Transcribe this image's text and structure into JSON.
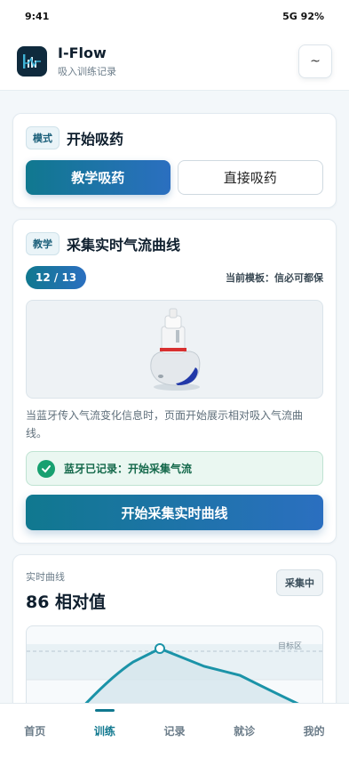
{
  "status_bar": {
    "time": "9:41",
    "signal": "5G 92%"
  },
  "header": {
    "title": "I-Flow",
    "subtitle": "吸入训练记录",
    "menu_icon": "tilde-icon"
  },
  "mode_card": {
    "tag": "模式",
    "title": "开始吸药",
    "options": [
      "教学吸药",
      "直接吸药"
    ],
    "selected": "教学吸药"
  },
  "teach_card": {
    "tag": "教学",
    "title": "采集实时气流曲线",
    "progress": "12 / 13",
    "template": "当前模板：信必可都保",
    "description": "当蓝牙传入气流变化信息时，页面开始展示相对吸入气流曲线。",
    "notice": "蓝牙已记录：开始采集气流",
    "action": "开始采集实时曲线"
  },
  "curve_card": {
    "label": "实时曲线",
    "value": "86 相对值",
    "status": "采集中",
    "target_label": "目标区"
  },
  "nav": {
    "items": [
      "首页",
      "训练",
      "记录",
      "就诊",
      "我的"
    ],
    "active": "训练"
  },
  "colors": {
    "brand": "#10788f",
    "accent": "#2b6fc0",
    "success": "#17a070"
  }
}
